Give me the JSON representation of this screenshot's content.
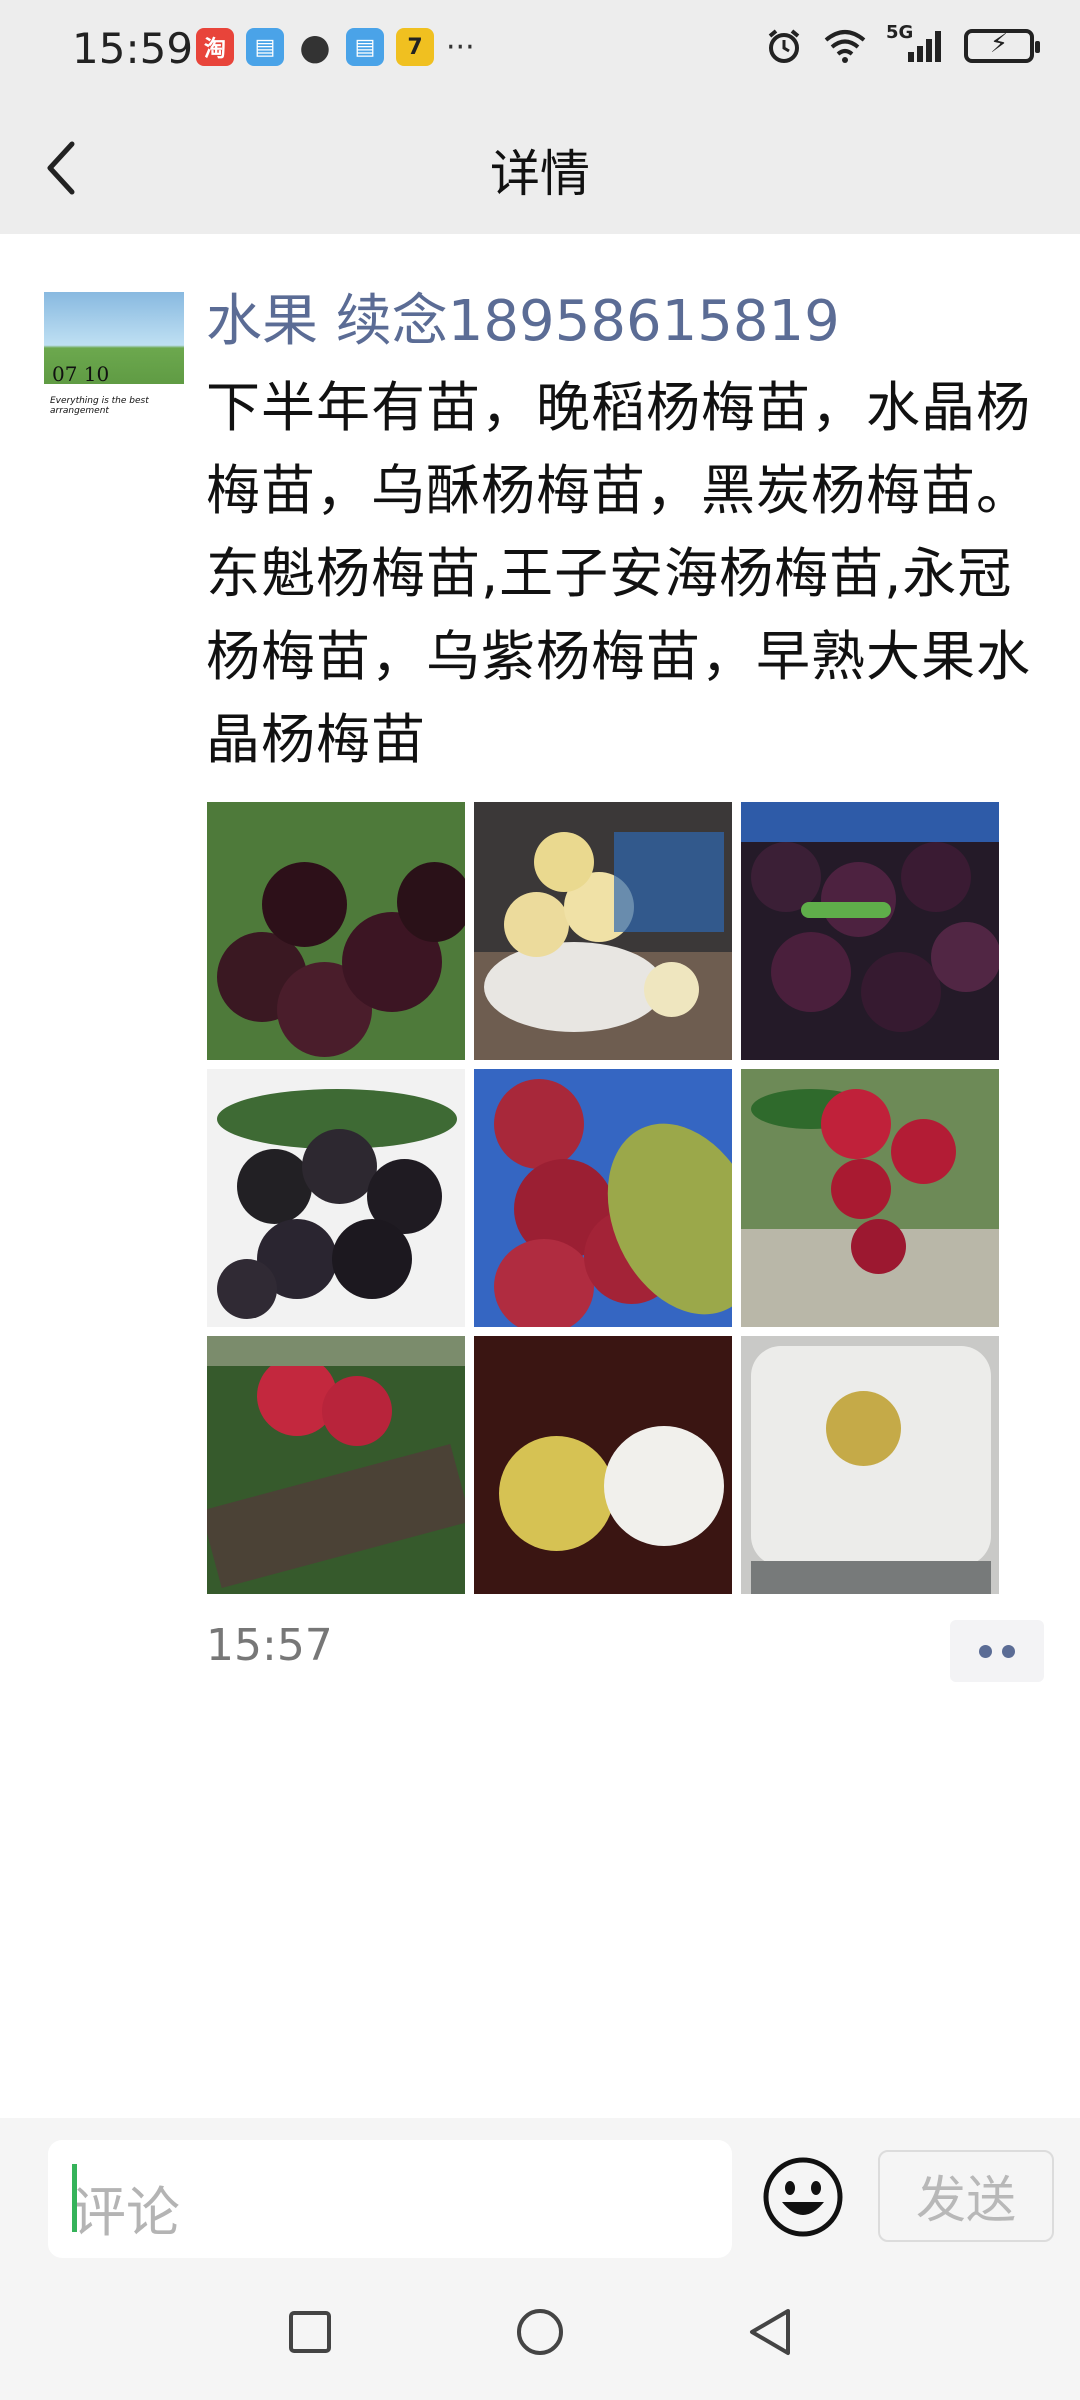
{
  "status_bar": {
    "time": "15:59",
    "apps": [
      {
        "icon": "taobao-icon",
        "glyph": "淘",
        "color": "#e8443a"
      },
      {
        "icon": "book-icon",
        "glyph": "▤",
        "color": "#4aa3e8"
      },
      {
        "icon": "chat-bubble-icon",
        "glyph": "●",
        "color": "#333333"
      },
      {
        "icon": "book-icon",
        "glyph": "▤",
        "color": "#4aa3e8"
      },
      {
        "icon": "cat-app-icon",
        "glyph": "7",
        "color": "#f0c020"
      }
    ],
    "more": "···",
    "network": "5G"
  },
  "header": {
    "title": "详情"
  },
  "post": {
    "avatar_text": "07 10",
    "avatar_subtext": "Everything is the best arrangement",
    "poster_name": "水果 续念18958615819",
    "text": "下半年有苗，晚稻杨梅苗，水晶杨梅苗，乌酥杨梅苗，黑炭杨梅苗。东魁杨梅苗,王子安海杨梅苗,永冠杨梅苗，乌紫杨梅苗，早熟大果水晶杨梅苗",
    "time": "15:57",
    "photos": [
      {
        "name": "dark-bayberries-on-branch-photo"
      },
      {
        "name": "white-bayberries-bowl-photo"
      },
      {
        "name": "dark-bayberries-pile-photo"
      },
      {
        "name": "black-bayberries-cluster-photo"
      },
      {
        "name": "red-bayberries-basket-photo"
      },
      {
        "name": "red-bayberries-tree-photo"
      },
      {
        "name": "red-bayberries-branch-photo"
      },
      {
        "name": "bayberry-and-ball-photo"
      },
      {
        "name": "bayberry-on-scale-photo"
      }
    ]
  },
  "comment": {
    "placeholder": "评论",
    "send_label": "发送"
  },
  "colors": {
    "name_link": "#5b6c95",
    "bar_bg": "#ededed",
    "cursor": "#35b35a"
  }
}
